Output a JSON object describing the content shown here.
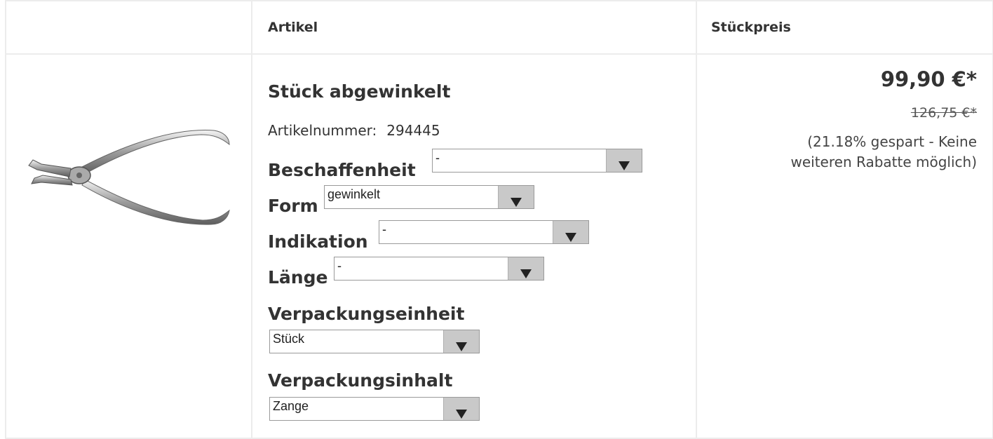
{
  "table": {
    "headers": [
      "",
      "Artikel",
      "Stückpreis"
    ]
  },
  "product": {
    "image_icon": "pliers-icon",
    "name": "Stück abgewinkelt",
    "article_number_label": "Artikelnummer:",
    "article_number": "294445",
    "options": [
      {
        "label": "Beschaffenheit",
        "value": "-"
      },
      {
        "label": "Form",
        "value": "gewinkelt"
      },
      {
        "label": "Indikation",
        "value": "-"
      },
      {
        "label": "Länge",
        "value": "-"
      },
      {
        "label": "Verpackungseinheit",
        "value": "Stück"
      },
      {
        "label": "Verpackungsinhalt",
        "value": "Zange"
      }
    ]
  },
  "price": {
    "current": "99,90 €*",
    "old": "126,75 €*",
    "saving_note": "(21.18% gespart - Keine weiteren Rabatte möglich)"
  },
  "colors": {
    "border": "#ececec",
    "select_button": "#c9c9c9",
    "text": "#333333"
  }
}
